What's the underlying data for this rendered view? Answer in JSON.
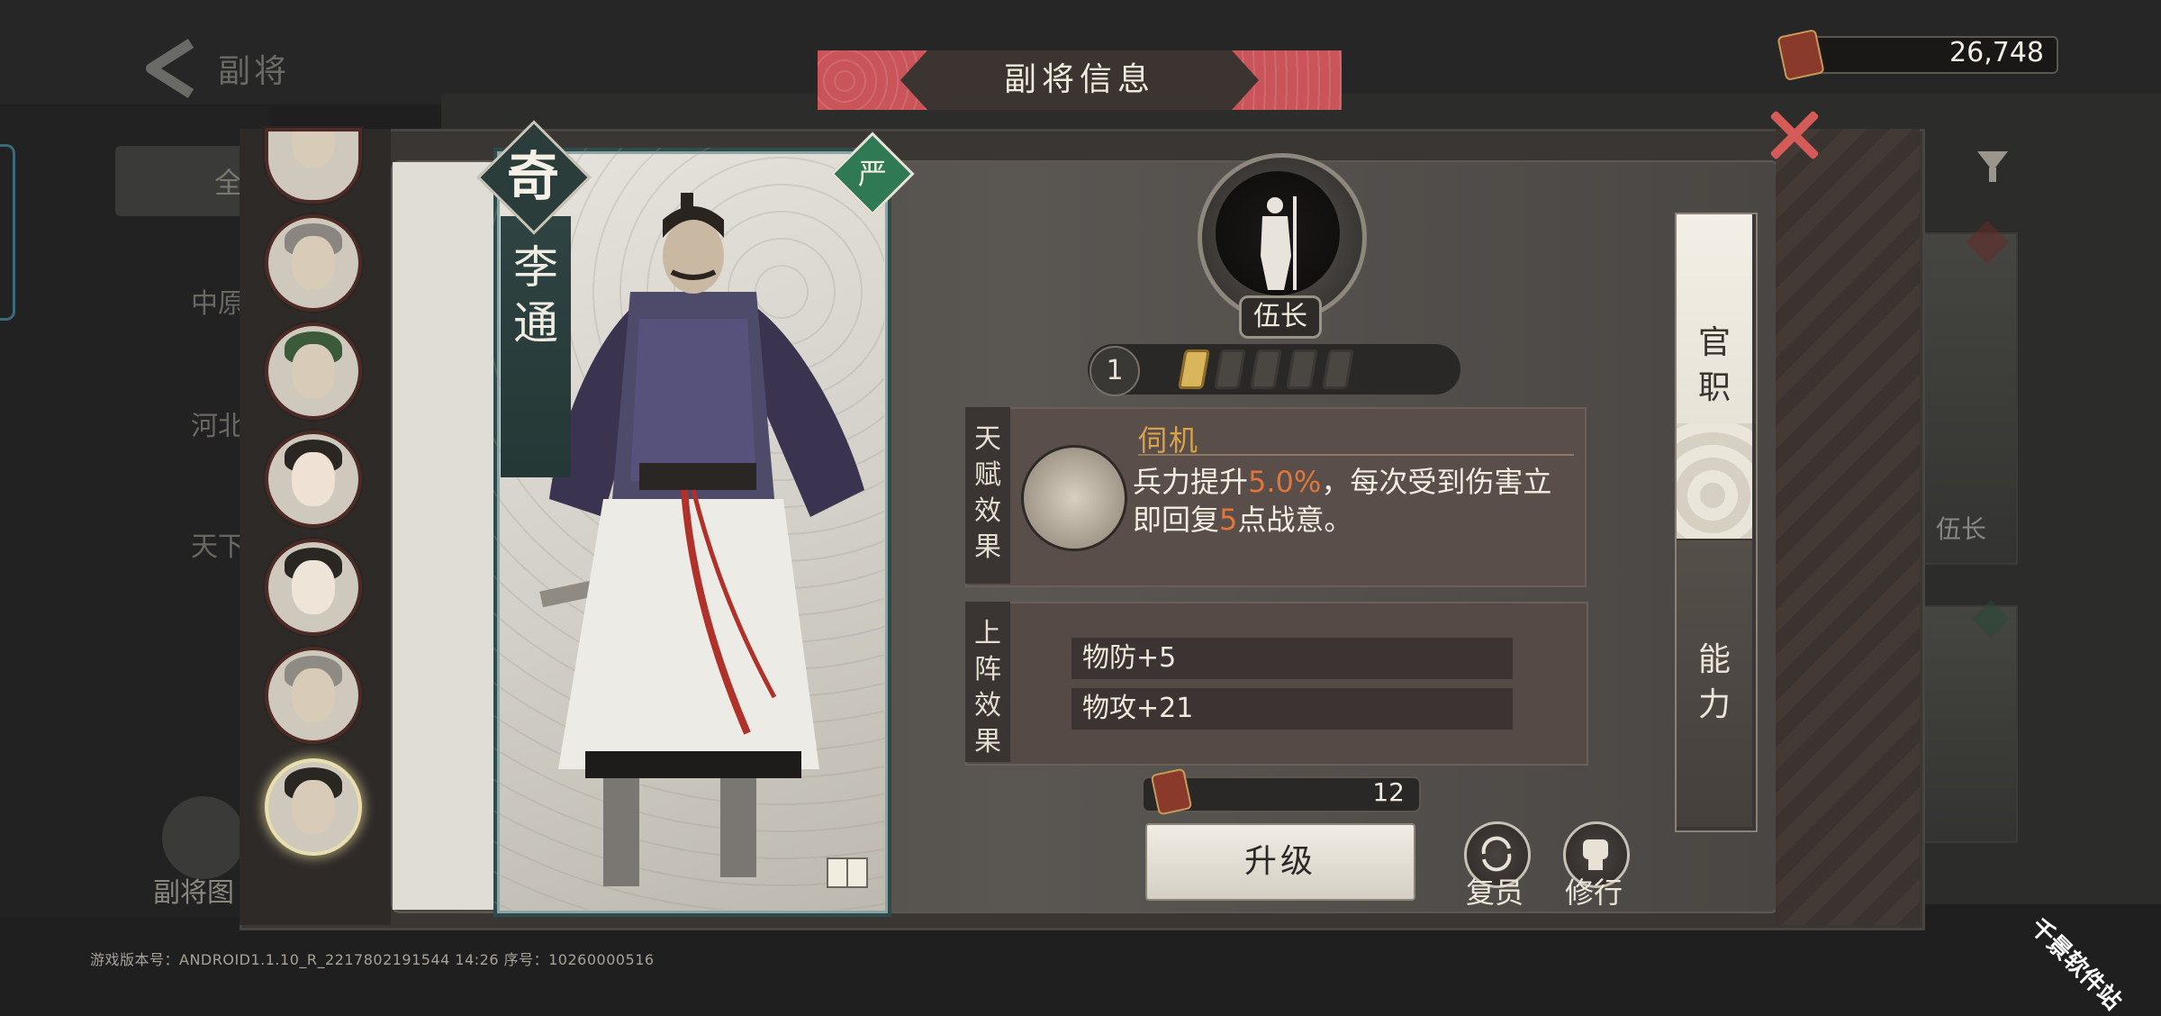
{
  "top_bar": {
    "back_label": "副将",
    "title": "副将信息",
    "currency_value": "26,748"
  },
  "background": {
    "filter_all": "全",
    "categories": [
      "中原",
      "河北",
      "天下"
    ],
    "gallery_label": "副将图",
    "right_card_label": "伍长",
    "version_text": "游戏版本号：ANDROID1.1.10_R_2217802191544 14:26 序号：10260000516",
    "watermark": "千景软件站"
  },
  "card": {
    "rarity": "奇",
    "name": "李通",
    "quality": "严"
  },
  "rank": {
    "title": "伍长",
    "level": "1",
    "stars_total": 5,
    "stars_filled": 1
  },
  "talent": {
    "side_label": "天赋效果",
    "name": "伺机",
    "desc_pre": "兵力提升",
    "desc_value1": "5.0%",
    "desc_mid": "，每次受到伤害立即回复",
    "desc_value2": "5",
    "desc_post": "点战意。"
  },
  "deploy": {
    "side_label": "上阵效果",
    "stats": [
      "物防+5",
      "物攻+21"
    ]
  },
  "actions": {
    "cost_value": "12",
    "upgrade_label": "升级",
    "demobilize_label": "复员",
    "train_label": "修行"
  },
  "tabs": [
    "官职",
    "能力"
  ],
  "colors": {
    "accent_red": "#c9545a",
    "highlight_orange": "#e0763a",
    "talent_gold": "#d9a24a",
    "quality_green": "#2f7a55"
  }
}
